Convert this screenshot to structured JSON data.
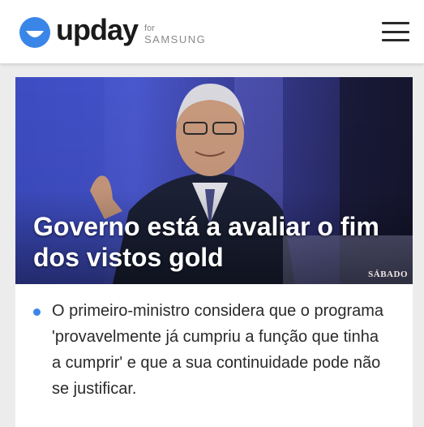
{
  "header": {
    "brand": "upday",
    "for_label": "for",
    "samsung_label": "SAMSUNG",
    "logo_icon": "upday-smile-icon",
    "menu_icon": "hamburger-menu-icon"
  },
  "article": {
    "headline": "Governo está a avaliar o fim dos vistos gold",
    "source": "SÁBADO",
    "summary": "O primeiro-ministro considera que o programa 'provavelmente já cumpriu a função que tinha a cumprir' e que a sua continuidade pode não se justificar."
  },
  "colors": {
    "brand_blue": "#3a86e8",
    "hero_blue": "#4a58cf"
  }
}
